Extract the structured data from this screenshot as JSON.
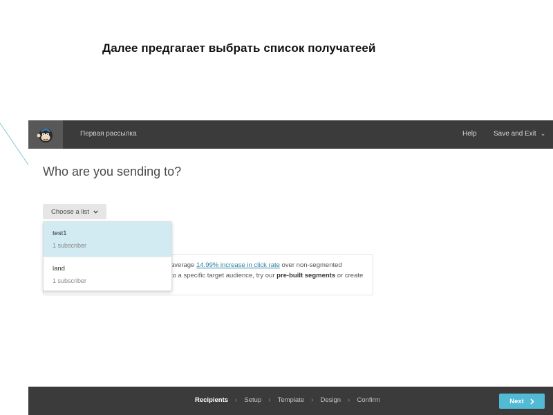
{
  "slide": {
    "title": "Далее предгагает выбрать список получатеей"
  },
  "app": {
    "topbar": {
      "logo_icon": "mailchimp-monkey-icon",
      "campaign_name": "Первая рассылка",
      "help": "Help",
      "save_exit": "Save and Exit"
    },
    "heading": "Who are you sending to?",
    "choose_list": {
      "label": "Choose a list"
    },
    "dropdown": {
      "items": [
        {
          "name": "test1",
          "subscribers": "1 subscriber",
          "selected": true
        },
        {
          "name": "land",
          "subscribers": "1 subscriber",
          "selected": false
        }
      ]
    },
    "info": {
      "line1_pre": "average ",
      "line1_link": "14.99% increase in click rate",
      "line1_post": " over non-segmented",
      "line2_pre": "to a specific target audience, try our ",
      "line2_bold": "pre-built segments",
      "line2_post": " or create"
    },
    "footer": {
      "steps": [
        "Recipients",
        "Setup",
        "Template",
        "Design",
        "Confirm"
      ],
      "active_step": "Recipients",
      "next": "Next"
    },
    "colors": {
      "topbar": "#3b3b3b",
      "logo_bg": "#585858",
      "accent": "#52bad5",
      "selected_row": "#d2eaf1",
      "link": "#2f7fa3"
    }
  }
}
